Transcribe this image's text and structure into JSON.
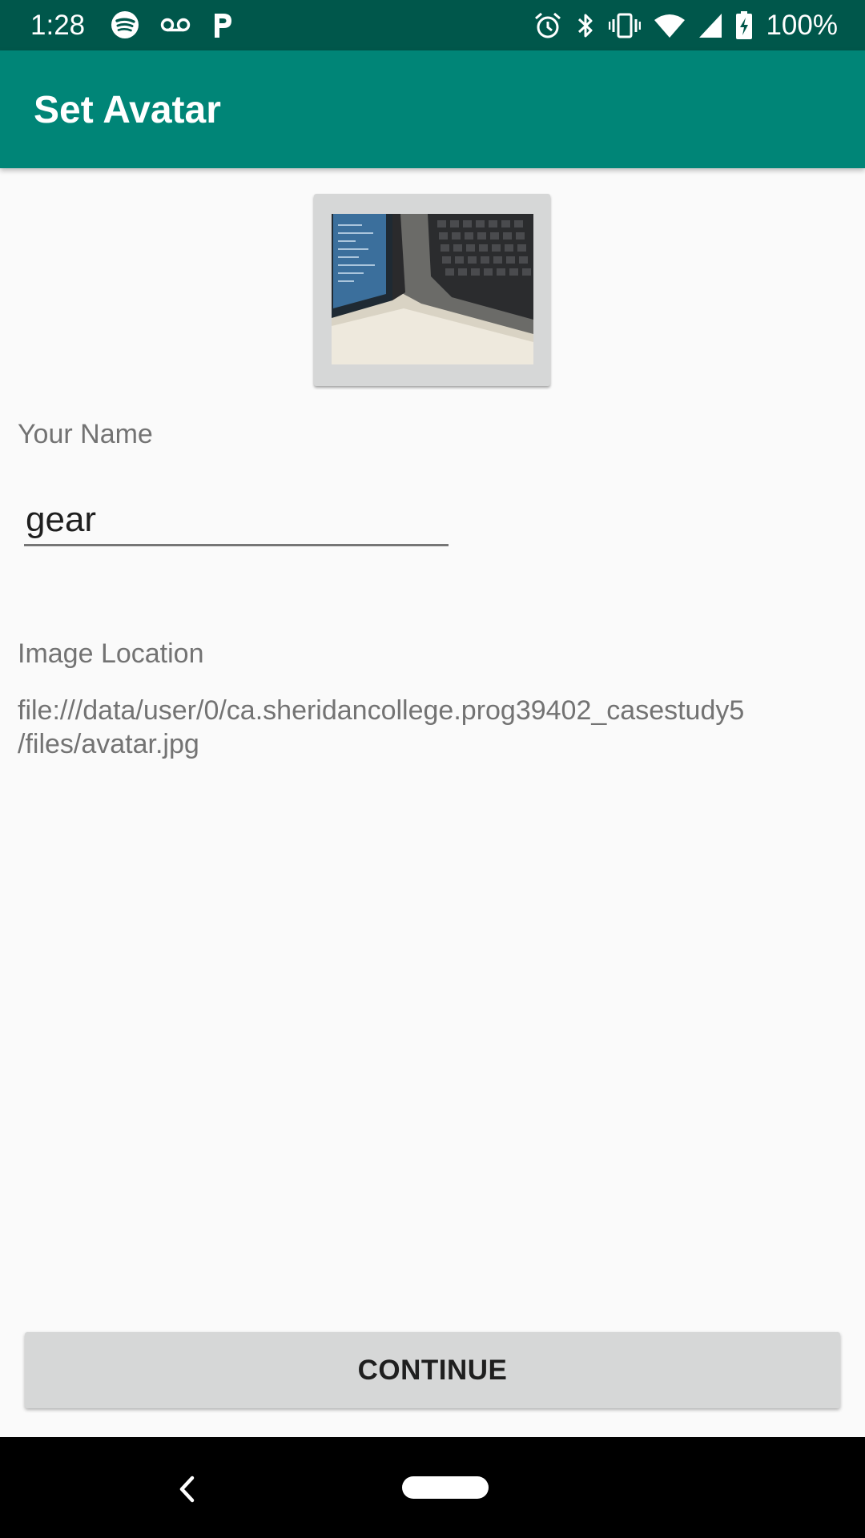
{
  "status_bar": {
    "time": "1:28",
    "battery_text": "100%",
    "left_icons": [
      "spotify-icon",
      "voicemail-icon",
      "parking-icon"
    ],
    "right_icons": [
      "alarm-icon",
      "bluetooth-icon",
      "vibrate-icon",
      "wifi-icon",
      "signal-icon",
      "battery-charging-icon"
    ]
  },
  "app_bar": {
    "title": "Set Avatar",
    "color": "#008577",
    "status_color": "#00574b"
  },
  "avatar": {
    "icon": "avatar-photo"
  },
  "form": {
    "name_label": "Your Name",
    "name_value": "gear",
    "location_label": "Image Location",
    "location_value": "file:///data/user/0/ca.sheridancollege.prog39402_casestudy5\n/files/avatar.jpg"
  },
  "actions": {
    "continue_label": "CONTINUE"
  },
  "nav_bar": {
    "icons": [
      "back-icon",
      "home-pill-icon"
    ]
  }
}
